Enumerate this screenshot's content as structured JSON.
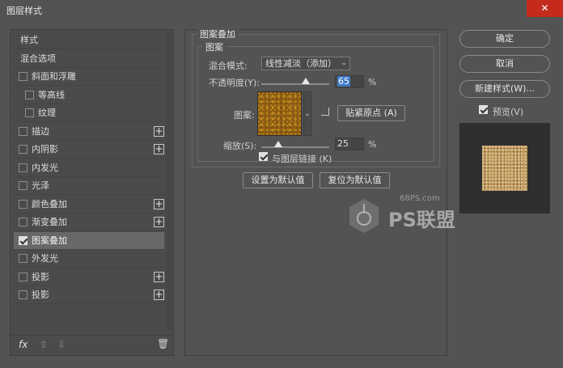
{
  "window": {
    "title": "图层样式",
    "close": "✕"
  },
  "sidebar": {
    "items": [
      {
        "label": "样式",
        "checkbox": false,
        "checked": false,
        "plus": false,
        "indent": false,
        "selected": false
      },
      {
        "label": "混合选项",
        "checkbox": false,
        "checked": false,
        "plus": false,
        "indent": false,
        "selected": false
      },
      {
        "label": "斜面和浮雕",
        "checkbox": true,
        "checked": false,
        "plus": false,
        "indent": false,
        "selected": false
      },
      {
        "label": "等高线",
        "checkbox": true,
        "checked": false,
        "plus": false,
        "indent": true,
        "selected": false
      },
      {
        "label": "纹理",
        "checkbox": true,
        "checked": false,
        "plus": false,
        "indent": true,
        "selected": false
      },
      {
        "label": "描边",
        "checkbox": true,
        "checked": false,
        "plus": true,
        "indent": false,
        "selected": false
      },
      {
        "label": "内阴影",
        "checkbox": true,
        "checked": false,
        "plus": true,
        "indent": false,
        "selected": false
      },
      {
        "label": "内发光",
        "checkbox": true,
        "checked": false,
        "plus": false,
        "indent": false,
        "selected": false
      },
      {
        "label": "光泽",
        "checkbox": true,
        "checked": false,
        "plus": false,
        "indent": false,
        "selected": false
      },
      {
        "label": "颜色叠加",
        "checkbox": true,
        "checked": false,
        "plus": true,
        "indent": false,
        "selected": false
      },
      {
        "label": "渐变叠加",
        "checkbox": true,
        "checked": false,
        "plus": true,
        "indent": false,
        "selected": false
      },
      {
        "label": "图案叠加",
        "checkbox": true,
        "checked": true,
        "plus": false,
        "indent": false,
        "selected": true
      },
      {
        "label": "外发光",
        "checkbox": true,
        "checked": false,
        "plus": false,
        "indent": false,
        "selected": false
      },
      {
        "label": "投影",
        "checkbox": true,
        "checked": false,
        "plus": true,
        "indent": false,
        "selected": false
      },
      {
        "label": "投影",
        "checkbox": true,
        "checked": false,
        "plus": true,
        "indent": false,
        "selected": false
      }
    ],
    "fx_label": "fx"
  },
  "pattern_overlay": {
    "group_title": "图案叠加",
    "sub_title": "图案",
    "blend_mode_label": "混合模式:",
    "blend_mode_value": "线性减淡（添加）",
    "opacity_label": "不透明度(Y):",
    "opacity_value": "65",
    "opacity_unit": "%",
    "opacity_fraction": 0.65,
    "pattern_label": "图案:",
    "snap_button": "贴紧原点 (A)",
    "scale_label": "缩放(S):",
    "scale_value": "25",
    "scale_unit": "%",
    "scale_fraction": 0.25,
    "link_label": "与图层链接 (K)",
    "link_checked": true,
    "set_default": "设置为默认值",
    "reset_default": "复位为默认值"
  },
  "actions": {
    "ok": "确定",
    "cancel": "取消",
    "new_style": "新建样式(W)...",
    "preview_label": "预览(V)",
    "preview_checked": true
  },
  "watermark": {
    "site": "68PS.com",
    "logo": "PS联盟"
  }
}
